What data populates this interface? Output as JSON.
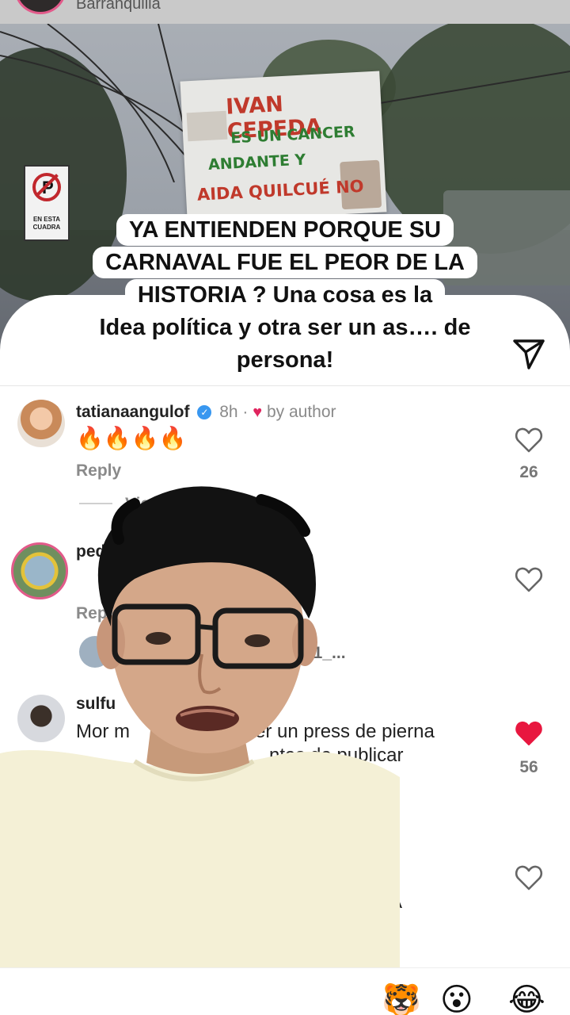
{
  "header": {
    "location": "Barranquilla"
  },
  "sign": {
    "parking_text": "EN ESTA CUADRA",
    "poster_text": "IVAN CEPEDA ES UN CANCER ANDANTE Y AIDA QUILCUÉ NO"
  },
  "caption": {
    "lines": [
      "YA ENTIENDEN PORQUE SU",
      "CARNAVAL FUE EL PEOR DE LA",
      "HISTORIA ? Una cosa es la",
      "Idea política y otra ser un as…. de",
      "persona!"
    ]
  },
  "comments": [
    {
      "username": "tatianaangulof",
      "time": "8h",
      "author_like": "by author",
      "text": "🔥🔥🔥🔥",
      "reply_label": "Reply",
      "likes": "26",
      "liked": false
    },
    {
      "username": "ped",
      "text": "",
      "reply_label": "Rep",
      "likes": "",
      "liked": false
    },
    {
      "username": "sulfu",
      "text_line1": "Mor m",
      "text_line1_end": "er un press de pierna",
      "text_line2_end": "ntes de publicar",
      "likes": "56",
      "liked": true
    }
  ],
  "view_replies_label": "View replies",
  "reply_preview_user_end": "e1_...",
  "fourth_comment_tail": "A",
  "emoji_bar": [
    "🐯",
    "😮",
    "😂"
  ],
  "colors": {
    "like_red": "#e8173f",
    "verified_blue": "#3897f0",
    "story_ring": "#e25a8a"
  }
}
